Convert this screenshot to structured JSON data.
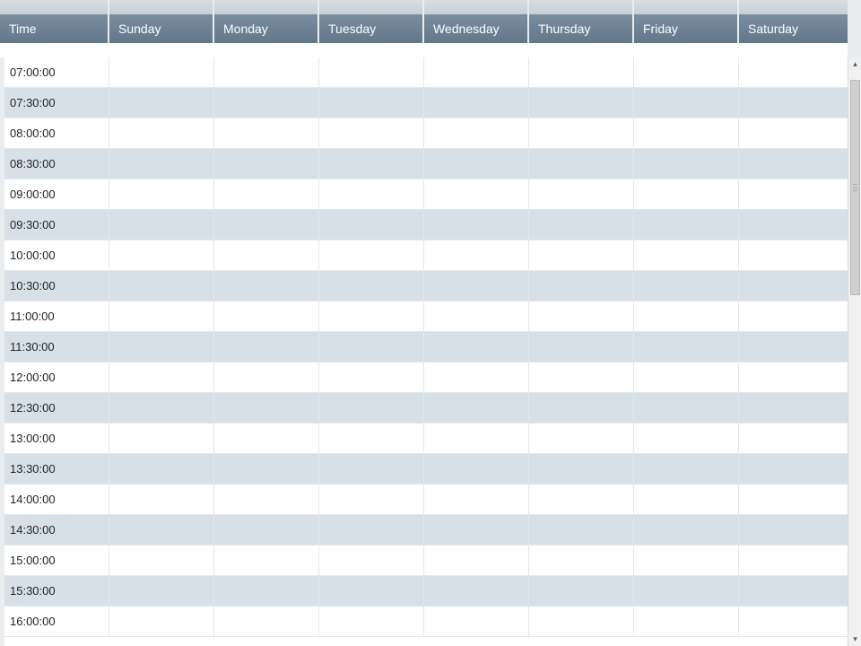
{
  "columns": {
    "time": "Time",
    "sunday": "Sunday",
    "monday": "Monday",
    "tuesday": "Tuesday",
    "wednesday": "Wednesday",
    "thursday": "Thursday",
    "friday": "Friday",
    "saturday": "Saturday"
  },
  "rows": [
    {
      "time": "07:00:00",
      "sunday": "",
      "monday": "",
      "tuesday": "",
      "wednesday": "",
      "thursday": "",
      "friday": "",
      "saturday": ""
    },
    {
      "time": "07:30:00",
      "sunday": "",
      "monday": "",
      "tuesday": "",
      "wednesday": "",
      "thursday": "",
      "friday": "",
      "saturday": ""
    },
    {
      "time": "08:00:00",
      "sunday": "",
      "monday": "",
      "tuesday": "",
      "wednesday": "",
      "thursday": "",
      "friday": "",
      "saturday": ""
    },
    {
      "time": "08:30:00",
      "sunday": "",
      "monday": "",
      "tuesday": "",
      "wednesday": "",
      "thursday": "",
      "friday": "",
      "saturday": ""
    },
    {
      "time": "09:00:00",
      "sunday": "",
      "monday": "",
      "tuesday": "",
      "wednesday": "",
      "thursday": "",
      "friday": "",
      "saturday": ""
    },
    {
      "time": "09:30:00",
      "sunday": "",
      "monday": "",
      "tuesday": "",
      "wednesday": "",
      "thursday": "",
      "friday": "",
      "saturday": ""
    },
    {
      "time": "10:00:00",
      "sunday": "",
      "monday": "",
      "tuesday": "",
      "wednesday": "",
      "thursday": "",
      "friday": "",
      "saturday": ""
    },
    {
      "time": "10:30:00",
      "sunday": "",
      "monday": "",
      "tuesday": "",
      "wednesday": "",
      "thursday": "",
      "friday": "",
      "saturday": ""
    },
    {
      "time": "11:00:00",
      "sunday": "",
      "monday": "",
      "tuesday": "",
      "wednesday": "",
      "thursday": "",
      "friday": "",
      "saturday": ""
    },
    {
      "time": "11:30:00",
      "sunday": "",
      "monday": "",
      "tuesday": "",
      "wednesday": "",
      "thursday": "",
      "friday": "",
      "saturday": ""
    },
    {
      "time": "12:00:00",
      "sunday": "",
      "monday": "",
      "tuesday": "",
      "wednesday": "",
      "thursday": "",
      "friday": "",
      "saturday": ""
    },
    {
      "time": "12:30:00",
      "sunday": "",
      "monday": "",
      "tuesday": "",
      "wednesday": "",
      "thursday": "",
      "friday": "",
      "saturday": ""
    },
    {
      "time": "13:00:00",
      "sunday": "",
      "monday": "",
      "tuesday": "",
      "wednesday": "",
      "thursday": "",
      "friday": "",
      "saturday": ""
    },
    {
      "time": "13:30:00",
      "sunday": "",
      "monday": "",
      "tuesday": "",
      "wednesday": "",
      "thursday": "",
      "friday": "",
      "saturday": ""
    },
    {
      "time": "14:00:00",
      "sunday": "",
      "monday": "",
      "tuesday": "",
      "wednesday": "",
      "thursday": "",
      "friday": "",
      "saturday": ""
    },
    {
      "time": "14:30:00",
      "sunday": "",
      "monday": "",
      "tuesday": "",
      "wednesday": "",
      "thursday": "",
      "friday": "",
      "saturday": ""
    },
    {
      "time": "15:00:00",
      "sunday": "",
      "monday": "",
      "tuesday": "",
      "wednesday": "",
      "thursday": "",
      "friday": "",
      "saturday": ""
    },
    {
      "time": "15:30:00",
      "sunday": "",
      "monday": "",
      "tuesday": "",
      "wednesday": "",
      "thursday": "",
      "friday": "",
      "saturday": ""
    },
    {
      "time": "16:00:00",
      "sunday": "",
      "monday": "",
      "tuesday": "",
      "wednesday": "",
      "thursday": "",
      "friday": "",
      "saturday": ""
    }
  ]
}
